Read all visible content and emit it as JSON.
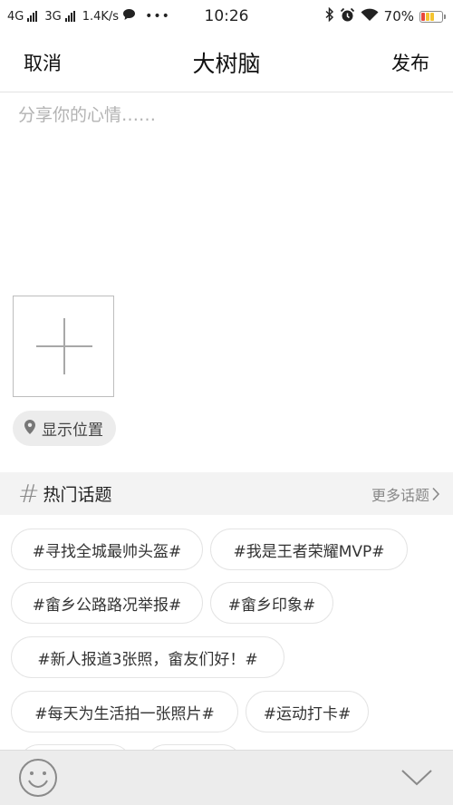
{
  "status_bar": {
    "net1": "4G",
    "net2": "3G",
    "speed": "1.4K/s",
    "time": "10:26",
    "battery": "70%",
    "icons": [
      "signal-icon",
      "chat-bubble-icon",
      "more-dots-icon",
      "bluetooth-icon",
      "alarm-icon",
      "wifi-icon",
      "battery-icon"
    ]
  },
  "header": {
    "cancel_label": "取消",
    "title": "大树脑",
    "publish_label": "发布"
  },
  "compose": {
    "placeholder": "分享你的心情……",
    "value": ""
  },
  "attachments": {
    "add_photo_icon": "plus-icon"
  },
  "location": {
    "label": "显示位置",
    "icon": "location-pin-icon"
  },
  "hot_topics": {
    "title": "热门话题",
    "more_label": "更多话题",
    "tags": [
      "#寻找全城最帅头盔#",
      "#我是王者荣耀MVP#",
      "#畲乡公路路况举报#",
      "#畲乡印象#",
      "#新人报道3张照，畲友们好！#",
      "#每天为生活拍一张照片#",
      "#运动打卡#"
    ]
  },
  "toolbar": {
    "emoji_icon": "smiley-icon",
    "collapse_icon": "chevron-down-icon"
  },
  "colors": {
    "divider": "#e2e2e2",
    "placeholder": "#b3b3b3",
    "section_bg": "#f3f3f3",
    "toolbar_bg": "#ececec",
    "battery_red": "#e8473c",
    "battery_yellow": "#f4c430"
  }
}
